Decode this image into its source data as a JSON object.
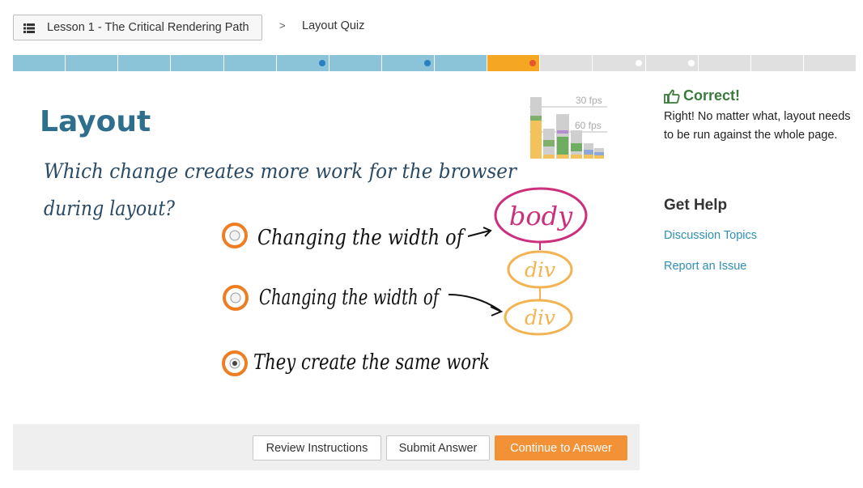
{
  "breadcrumb": {
    "lesson_label": "Lesson 1 - The Critical Rendering Path",
    "separator": ">",
    "current": "Layout Quiz"
  },
  "progress": {
    "segments": [
      {
        "state": "done"
      },
      {
        "state": "done"
      },
      {
        "state": "done"
      },
      {
        "state": "done"
      },
      {
        "state": "done"
      },
      {
        "state": "done",
        "dot": "blue"
      },
      {
        "state": "done"
      },
      {
        "state": "done",
        "dot": "blue"
      },
      {
        "state": "done"
      },
      {
        "state": "current",
        "dot": "red"
      },
      {
        "state": "todo"
      },
      {
        "state": "todo",
        "dot": "white"
      },
      {
        "state": "todo",
        "dot": "white"
      },
      {
        "state": "todo"
      },
      {
        "state": "todo"
      },
      {
        "state": "todo"
      }
    ],
    "colors": {
      "done": "#8bc4d8",
      "current": "#f5a623",
      "todo": "#e0e0e0",
      "blue": "#2a7fc0",
      "red": "#e4572e",
      "white": "#ffffff"
    }
  },
  "quiz": {
    "title": "Layout",
    "question_line1": "Which change creates more work for the browser",
    "question_line2": "during layout?",
    "options": [
      {
        "text": "Changing the width of",
        "selected": false
      },
      {
        "text": "Changing the width of",
        "selected": false
      },
      {
        "text": "They create the same work",
        "selected": true
      }
    ],
    "tree": {
      "root": "body",
      "child1": "div",
      "child2": "div"
    },
    "fps_labels": {
      "top": "30 fps",
      "bottom": "60 fps"
    },
    "colors": {
      "title": "#2e6f8e",
      "handwriting": "#2b4a63",
      "radio": "#ef7d22",
      "body": "#cc2f7c",
      "div": "#f2b453"
    }
  },
  "footer": {
    "review": "Review Instructions",
    "submit": "Submit Answer",
    "continue": "Continue to Answer"
  },
  "feedback": {
    "title": "Correct!",
    "text": "Right! No matter what, layout needs to be run against the whole page."
  },
  "help": {
    "title": "Get Help",
    "links": [
      "Discussion Topics",
      "Report an Issue"
    ]
  }
}
